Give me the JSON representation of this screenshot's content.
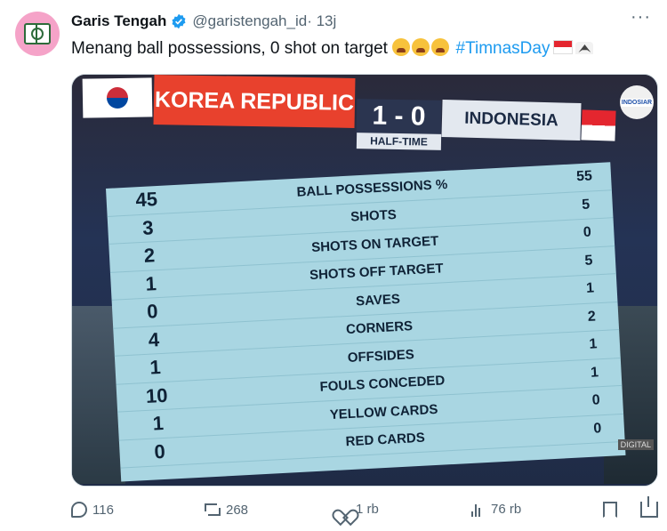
{
  "tweet": {
    "display_name": "Garis Tengah",
    "handle": "@garistengah_id",
    "time": "· 13j",
    "text": "Menang ball possessions, 0 shot on target ",
    "hashtag": "#TimnasDay",
    "more_label": "···"
  },
  "scoreboard": {
    "home_team": "KOREA REPUBLIC",
    "score": "1 - 0",
    "status": "HALF-TIME",
    "away_team": "INDONESIA",
    "broadcaster": "INDOSIAR",
    "watermark": "DIGITAL"
  },
  "stats": [
    {
      "left": "45",
      "label": "BALL POSSESSIONS %",
      "right": "55"
    },
    {
      "left": "3",
      "label": "SHOTS",
      "right": "5"
    },
    {
      "left": "2",
      "label": "SHOTS ON TARGET",
      "right": "0"
    },
    {
      "left": "1",
      "label": "SHOTS OFF TARGET",
      "right": "5"
    },
    {
      "left": "0",
      "label": "SAVES",
      "right": "1"
    },
    {
      "left": "4",
      "label": "CORNERS",
      "right": "2"
    },
    {
      "left": "1",
      "label": "OFFSIDES",
      "right": "1"
    },
    {
      "left": "10",
      "label": "FOULS CONCEDED",
      "right": "1"
    },
    {
      "left": "1",
      "label": "YELLOW CARDS",
      "right": "0"
    },
    {
      "left": "0",
      "label": "RED CARDS",
      "right": "0"
    }
  ],
  "actions": {
    "replies": "116",
    "reposts": "268",
    "likes": "1 rb",
    "views": "76 rb"
  },
  "icons": {
    "verified": "verified-badge-icon",
    "reply": "reply-icon",
    "repost": "repost-icon",
    "like": "heart-icon",
    "views": "views-icon",
    "bookmark": "bookmark-icon",
    "share": "share-icon"
  },
  "colors": {
    "link": "#1d9bf0",
    "secondary_text": "#536471",
    "home_team_bar": "#e8412d",
    "stats_panel": "#a9d6e2"
  }
}
